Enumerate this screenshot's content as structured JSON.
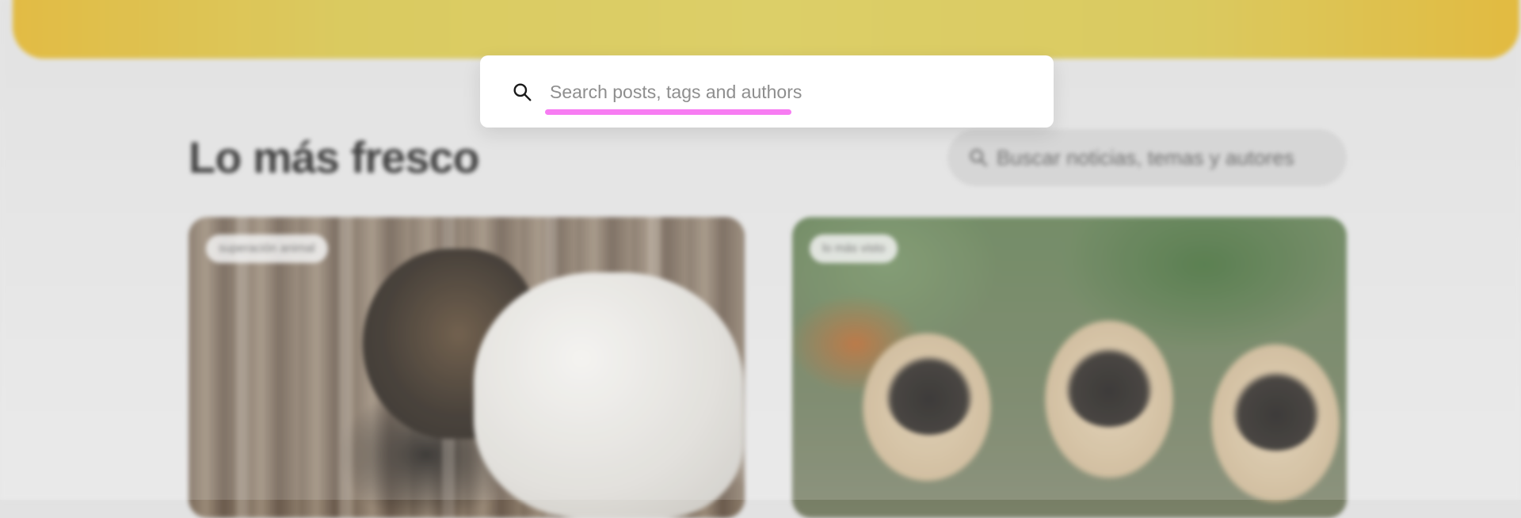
{
  "search": {
    "placeholder": "Search posts, tags and authors",
    "value": ""
  },
  "background": {
    "section_title": "Lo más fresco",
    "search_placeholder": "Buscar noticias, temas y autores",
    "cards": [
      {
        "tag": "superación animal"
      },
      {
        "tag": "lo más visto"
      }
    ]
  },
  "colors": {
    "accent_yellow": "#D6C74E",
    "highlight_pink": "#F77CF2"
  },
  "icons": {
    "search": "magnifying-glass"
  }
}
